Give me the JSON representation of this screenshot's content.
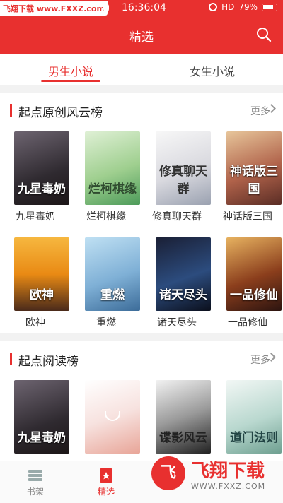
{
  "status_bar": {
    "watermark_text": "飞翔下载 www.FXXZ.com",
    "time": "16:36:04",
    "network": "HD",
    "battery": "79%"
  },
  "header": {
    "title": "精选",
    "search_icon": "search-icon"
  },
  "tabs": [
    {
      "label": "男生小说",
      "active": true
    },
    {
      "label": "女生小说",
      "active": false
    }
  ],
  "sections": [
    {
      "title": "起点原创风云榜",
      "more": "更多",
      "books": [
        {
          "title": "九星毒奶",
          "cover_text": "九星毒奶"
        },
        {
          "title": "烂柯棋缘",
          "cover_text": "烂柯棋缘"
        },
        {
          "title": "修真聊天群",
          "cover_text": "修真聊天群"
        },
        {
          "title": "神话版三国",
          "cover_text": "神话版三国"
        },
        {
          "title": "欧神",
          "cover_text": "欧神"
        },
        {
          "title": "重燃",
          "cover_text": "重燃"
        },
        {
          "title": "诸天尽头",
          "cover_text": "诸天尽头"
        },
        {
          "title": "一品修仙",
          "cover_text": "一品修仙"
        }
      ]
    },
    {
      "title": "起点阅读榜",
      "more": "更多",
      "books": [
        {
          "cover_text": "九星毒奶"
        },
        {
          "cover_text": ""
        },
        {
          "cover_text": "谍影风云"
        },
        {
          "cover_text": "道门法则"
        }
      ]
    }
  ],
  "tab_bar": [
    {
      "label": "书架",
      "icon": "bookshelf-icon",
      "active": false
    },
    {
      "label": "精选",
      "icon": "featured-icon",
      "active": true
    },
    {
      "label": "",
      "icon": "",
      "active": false
    },
    {
      "label": "",
      "icon": "",
      "active": false
    }
  ],
  "watermark": {
    "logo": "飞翔下载",
    "url": "WWW.FXXZ.COM"
  }
}
